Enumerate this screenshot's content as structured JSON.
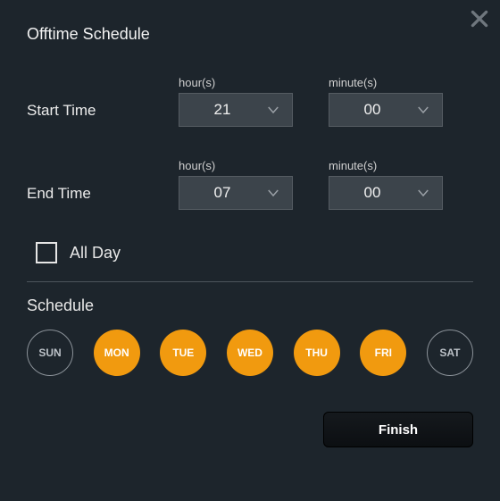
{
  "title": "Offtime Schedule",
  "start": {
    "label": "Start Time",
    "hour": {
      "label": "hour(s)",
      "value": "21"
    },
    "minute": {
      "label": "minute(s)",
      "value": "00"
    }
  },
  "end": {
    "label": "End Time",
    "hour": {
      "label": "hour(s)",
      "value": "07"
    },
    "minute": {
      "label": "minute(s)",
      "value": "00"
    }
  },
  "allday": {
    "label": "All Day",
    "checked": false
  },
  "schedule": {
    "label": "Schedule",
    "days": [
      {
        "abbr": "SUN",
        "selected": false
      },
      {
        "abbr": "MON",
        "selected": true
      },
      {
        "abbr": "TUE",
        "selected": true
      },
      {
        "abbr": "WED",
        "selected": true
      },
      {
        "abbr": "THU",
        "selected": true
      },
      {
        "abbr": "FRI",
        "selected": true
      },
      {
        "abbr": "SAT",
        "selected": false
      }
    ]
  },
  "finish": "Finish"
}
